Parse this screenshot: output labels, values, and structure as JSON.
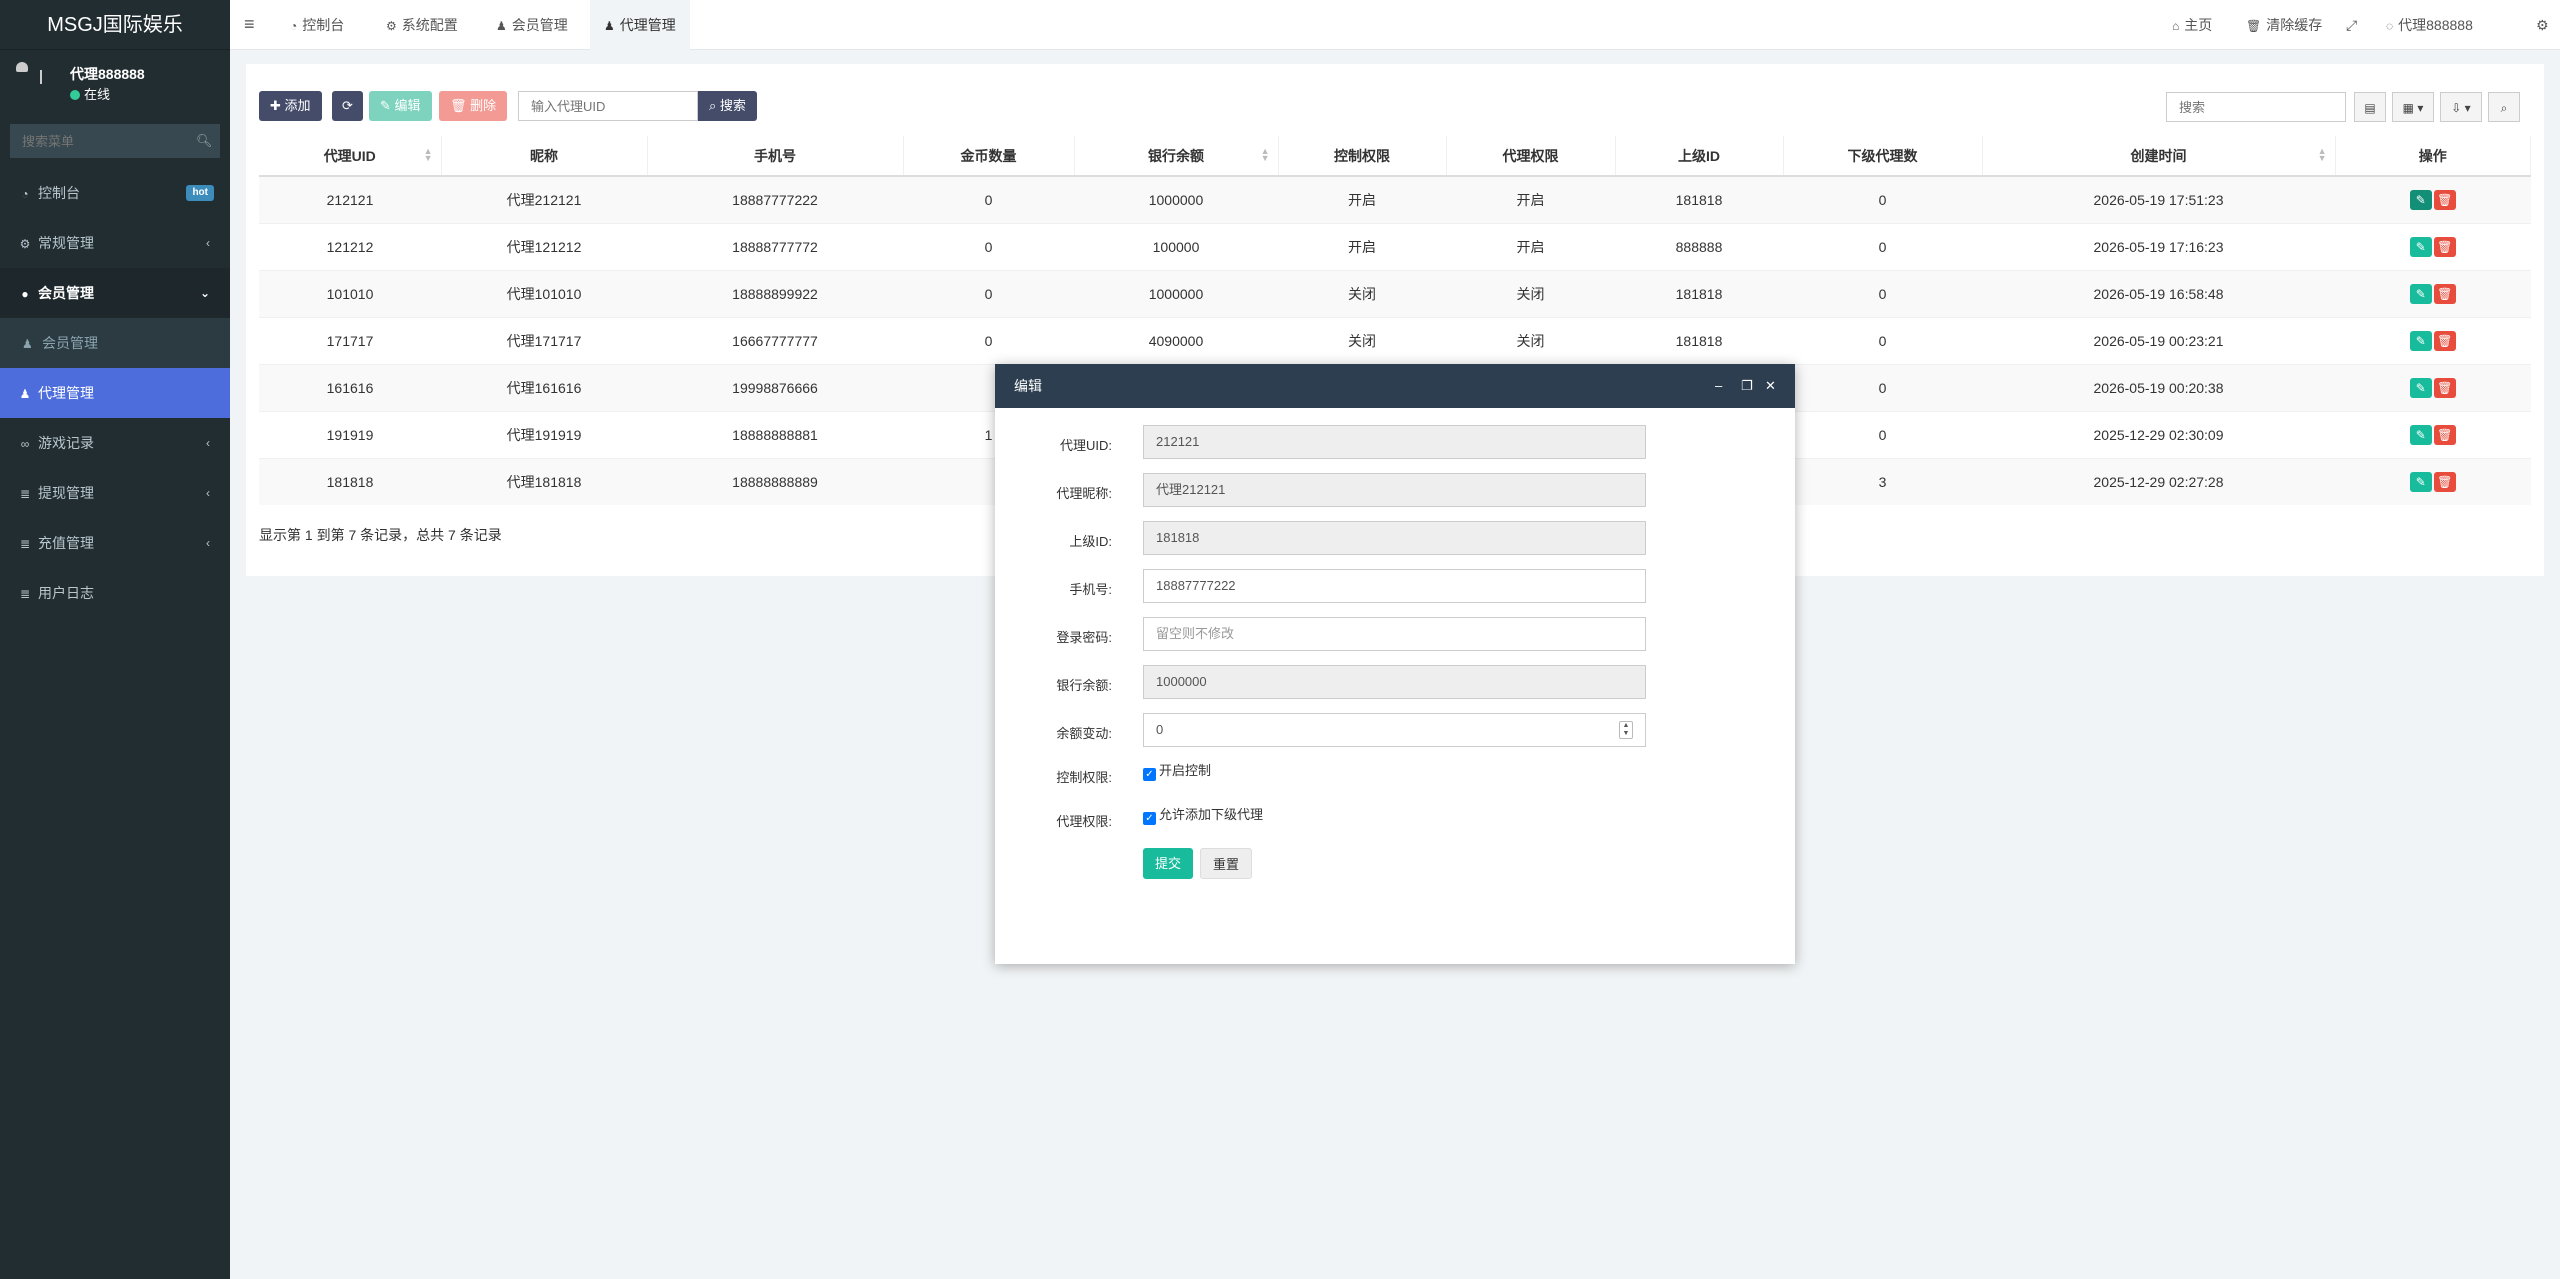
{
  "app": {
    "title": "MSGJ国际娱乐"
  },
  "user": {
    "name": "代理888888",
    "status": "在线"
  },
  "sidebar": {
    "search_placeholder": "搜索菜单",
    "items": [
      {
        "label": "控制台",
        "badge": "hot"
      },
      {
        "label": "常规管理"
      },
      {
        "label": "会员管理"
      },
      {
        "label": "会员管理"
      },
      {
        "label": "代理管理"
      },
      {
        "label": "游戏记录"
      },
      {
        "label": "提现管理"
      },
      {
        "label": "充值管理"
      },
      {
        "label": "用户日志"
      }
    ]
  },
  "topbar": {
    "tabs": [
      "控制台",
      "系统配置",
      "会员管理",
      "代理管理"
    ],
    "home": "主页",
    "clear_cache": "清除缓存",
    "user": "代理888888"
  },
  "toolbar": {
    "add": "添加",
    "edit": "编辑",
    "delete": "删除",
    "uid_placeholder": "输入代理UID",
    "search": "搜索",
    "right_search_placeholder": "搜索"
  },
  "table": {
    "columns": [
      "代理UID",
      "昵称",
      "手机号",
      "金币数量",
      "银行余额",
      "控制权限",
      "代理权限",
      "上级ID",
      "下级代理数",
      "创建时间",
      "操作"
    ],
    "rows": [
      [
        "212121",
        "代理212121",
        "18887777222",
        "0",
        "1000000",
        "开启",
        "开启",
        "181818",
        "0",
        "2026-05-19 17:51:23"
      ],
      [
        "121212",
        "代理121212",
        "18888777772",
        "0",
        "100000",
        "开启",
        "开启",
        "888888",
        "0",
        "2026-05-19 17:16:23"
      ],
      [
        "101010",
        "代理101010",
        "18888899922",
        "0",
        "1000000",
        "关闭",
        "关闭",
        "181818",
        "0",
        "2026-05-19 16:58:48"
      ],
      [
        "171717",
        "代理171717",
        "16667777777",
        "0",
        "4090000",
        "关闭",
        "关闭",
        "181818",
        "0",
        "2026-05-19 00:23:21"
      ],
      [
        "161616",
        "代理161616",
        "19998876666",
        "",
        "",
        "",
        "",
        "",
        "0",
        "2026-05-19 00:20:38"
      ],
      [
        "191919",
        "代理191919",
        "18888888881",
        "1",
        "",
        "",
        "",
        "",
        "0",
        "2025-12-29 02:30:09"
      ],
      [
        "181818",
        "代理181818",
        "18888888889",
        "",
        "",
        "",
        "",
        "",
        "3",
        "2025-12-29 02:27:28"
      ]
    ],
    "page_info": "显示第 1 到第 7 条记录，总共 7 条记录"
  },
  "dialog": {
    "title": "编辑",
    "fields": {
      "uid_label": "代理UID:",
      "uid_value": "212121",
      "nick_label": "代理昵称:",
      "nick_value": "代理212121",
      "parent_label": "上级ID:",
      "parent_value": "181818",
      "phone_label": "手机号:",
      "phone_value": "18887777222",
      "pwd_label": "登录密码:",
      "pwd_placeholder": "留空则不修改",
      "bank_label": "银行余额:",
      "bank_value": "1000000",
      "change_label": "余额变动:",
      "change_value": "0",
      "ctrl_label": "控制权限:",
      "ctrl_check": "开启控制",
      "agent_label": "代理权限:",
      "agent_check": "允许添加下级代理"
    },
    "submit": "提交",
    "reset": "重置"
  },
  "colors": {
    "sidebar_bg": "#222d32",
    "active_menu": "#4d6ddc",
    "dialog_header": "#2c3e50",
    "primary": "#18bc9c",
    "danger": "#e74c3c"
  }
}
